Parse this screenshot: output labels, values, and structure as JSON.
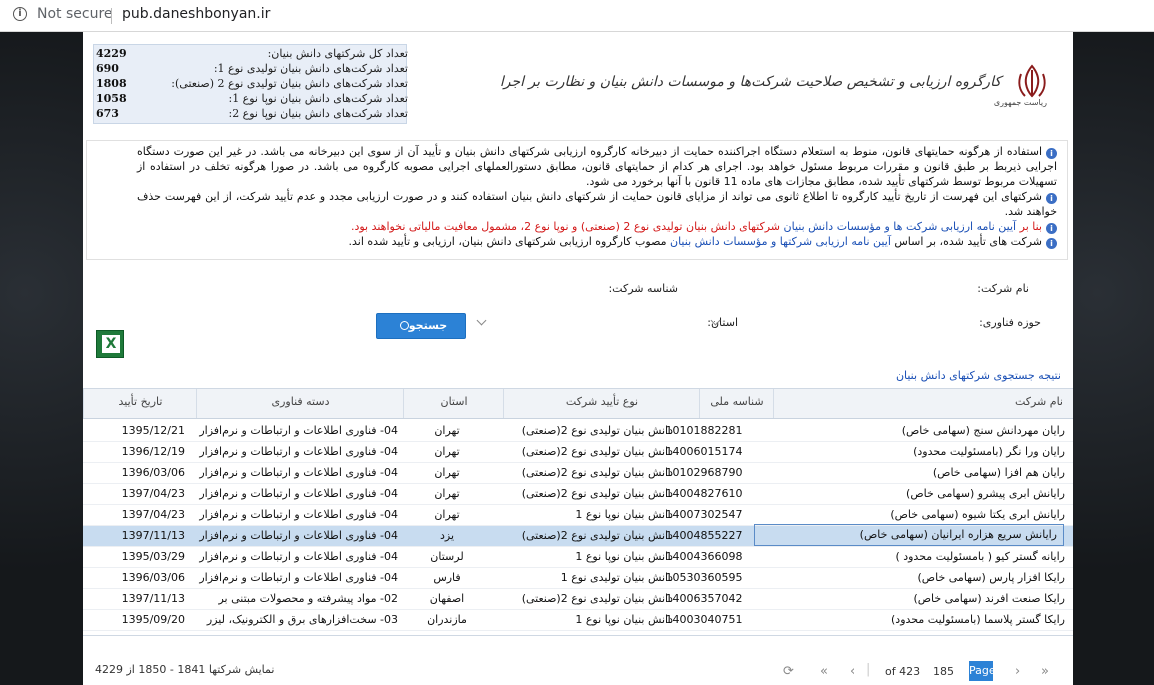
{
  "browser": {
    "security": "Not secure",
    "url": "pub.daneshbonyan.ir"
  },
  "stats": [
    {
      "label": "تعداد کل شرکتهای دانش بنیان:",
      "value": "4229"
    },
    {
      "label": "تعداد شرکت‌های دانش بنیان تولیدی نوع 1:",
      "value": "690"
    },
    {
      "label": "تعداد شرکت‌های دانش بنیان تولیدی نوع 2 (صنعتی):",
      "value": "1808"
    },
    {
      "label": "تعداد شرکت‌های دانش بنیان نوپا نوع 1:",
      "value": "1058"
    },
    {
      "label": "تعداد شرکت‌های دانش بنیان نوپا نوع 2:",
      "value": "673"
    }
  ],
  "logo": {
    "title": "کارگروه ارزیابی و تشخیص صلاحیت شرکت‌ها و موسسات دانش بنیان و نظارت بر اجرا",
    "subtitle": "ریاست جمهوری"
  },
  "notices": {
    "p1": "استفاده از هرگونه حمایتهای قانون، منوط به استعلام دستگاه اجراکننده حمایت از دبیرخانه کارگروه ارزیابی شرکتهای دانش بنیان و تأیید آن از سوی این دبیرخانه می باشد. در غیر این صورت دستگاه اجرایی ذیربط بر طبق قانون و مقررات مربوط مسئول خواهد بود. اجرای هر کدام از حمایتهای قانون، مطابق دستورالعملهای اجرایی مصوبه کارگروه می باشد. در صورا هرگونه تخلف در استفاده از تسهیلات مربوط توسط شرکتهای تأیید شده، مطابق مجازات های ماده 11 قانون با آنها برخورد می شود.",
    "p2": "شرکتهای این فهرست از تاریخ تأیید کارگروه تا اطلاع ثانوی می تواند از مزایای قانون حمایت از شرکتهای دانش بنیان استفاده کنند و در صورت ارزیابی مجدد و عدم تأیید شرکت، از این فهرست حذف خواهند شد.",
    "p3_start": "بنا بر",
    "p3_link": "آیین نامه ارزیابی شرکت ها و مؤسسات دانش بنیان",
    "p3_end": "شرکتهای دانش بنیان تولیدی نوع 2 (صنعتی) و نوپا نوع 2، مشمول معافیت مالیاتی نخواهند بود.",
    "p4_start": "شرکت های تأیید شده، بر اساس",
    "p4_link": "آیین نامه ارزیابی شرکتها و مؤسسات دانش بنیان",
    "p4_end": "مصوب کارگروه ارزیابی شرکتهای دانش بنیان، ارزیابی و تأیید شده اند."
  },
  "form": {
    "company_name_label": "نام شرکت:",
    "national_id_label": "شناسه شرکت:",
    "tech_field_label": "حوزه فناوری:",
    "province_label": "استان:",
    "search_button": "جستجو"
  },
  "results_title": "نتیجه جستجوی شرکتهای دانش بنیان",
  "columns": {
    "name": "نام شرکت",
    "national_id": "شناسه ملی",
    "type": "نوع تأیید شرکت",
    "province": "استان",
    "tech": "دسته فناوری",
    "date": "تاریخ تأیید"
  },
  "rows": [
    {
      "name": "رایان مهردانش سنج (سهامی خاص)",
      "id": "10101882281",
      "type": "دانش بنیان تولیدی نوع 2(صنعتی)",
      "province": "تهران",
      "tech": "04- فناوری اطلاعات و ارتباطات و نرم‌افزار",
      "date": "1395/12/21"
    },
    {
      "name": "رایان ورا نگر (بامسئولیت محدود)",
      "id": "14006015174",
      "type": "دانش بنیان تولیدی نوع 2(صنعتی)",
      "province": "تهران",
      "tech": "04- فناوری اطلاعات و ارتباطات و نرم‌افزار",
      "date": "1396/12/19"
    },
    {
      "name": "رایان هم افزا (سهامی خاص)",
      "id": "10102968790",
      "type": "دانش بنیان تولیدی نوع 2(صنعتی)",
      "province": "تهران",
      "tech": "04- فناوری اطلاعات و ارتباطات و نرم‌افزار",
      "date": "1396/03/06"
    },
    {
      "name": "رایانش ابری پیشرو (سهامی خاص)",
      "id": "14004827610",
      "type": "دانش بنیان تولیدی نوع 2(صنعتی)",
      "province": "تهران",
      "tech": "04- فناوری اطلاعات و ارتباطات و نرم‌افزار",
      "date": "1397/04/23"
    },
    {
      "name": "رایانش ابری یکتا شیوه (سهامی خاص)",
      "id": "14007302547",
      "type": "دانش بنیان نوپا نوع 1",
      "province": "تهران",
      "tech": "04- فناوری اطلاعات و ارتباطات و نرم‌افزار",
      "date": "1397/04/23"
    },
    {
      "name": "رایانش سریع هزاره ایرانیان (سهامی خاص)",
      "id": "14004855227",
      "type": "دانش بنیان تولیدی نوع 2(صنعتی)",
      "province": "یزد",
      "tech": "04- فناوری اطلاعات و ارتباطات و نرم‌افزار",
      "date": "1397/11/13"
    },
    {
      "name": "رایانه گستر کیو ( بامسئولیت محدود )",
      "id": "14004366098",
      "type": "دانش بنیان نوپا نوع 1",
      "province": "لرستان",
      "tech": "04- فناوری اطلاعات و ارتباطات و نرم‌افزار",
      "date": "1395/03/29"
    },
    {
      "name": "رایکا افزار پارس (سهامی خاص)",
      "id": "10530360595",
      "type": "دانش بنیان تولیدی نوع 1",
      "province": "فارس",
      "tech": "04- فناوری اطلاعات و ارتباطات و نرم‌افزار",
      "date": "1396/03/06"
    },
    {
      "name": "رایکا صنعت افرند (سهامی خاص)",
      "id": "14006357042",
      "type": "دانش بنیان تولیدی نوع 2(صنعتی)",
      "province": "اصفهان",
      "tech": "02- مواد پیشرفته و محصولات مبتنی بر",
      "date": "1397/11/13"
    },
    {
      "name": "رایکا گستر پلاسما (بامسئولیت محدود)",
      "id": "14003040751",
      "type": "دانش بنیان نوپا نوع 1",
      "province": "مازندران",
      "tech": "03- سخت‌افزارهای برق و الکترونیک، لیزر",
      "date": "1395/09/20"
    }
  ],
  "footer": {
    "range": "نمایش شرکتها 1841 - 1850 از 4229",
    "page_label": "Page",
    "current_page": "185",
    "of_pages": "of 423"
  },
  "colors": {
    "accent": "#2c82d6",
    "selected_row": "#c8dcf0",
    "link": "#1a4fb5",
    "warning": "#d31919"
  }
}
